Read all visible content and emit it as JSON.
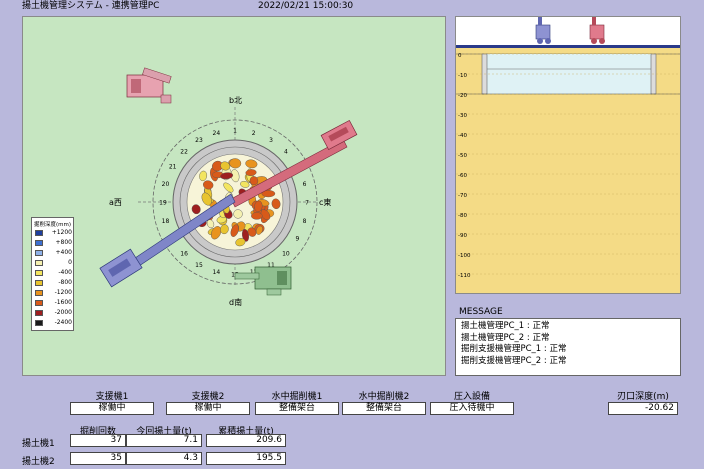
{
  "window": {
    "title": "揚土機管理システム - 連携管理PC",
    "datetime": "2022/02/21 15:00:30"
  },
  "plan": {
    "directions": {
      "north": "b北",
      "east": "c東",
      "south": "d南",
      "west": "a西"
    },
    "legend": {
      "title": "掘削深度(mm)",
      "items": [
        {
          "label": "+1200",
          "color": "#1f3f9e"
        },
        {
          "label": "+800",
          "color": "#3d6fd0"
        },
        {
          "label": "+400",
          "color": "#8fb1e8"
        },
        {
          "label": "0",
          "color": "#f4f0b0"
        },
        {
          "label": "-400",
          "color": "#f3e560"
        },
        {
          "label": "-800",
          "color": "#e8c430"
        },
        {
          "label": "-1200",
          "color": "#e8931e"
        },
        {
          "label": "-1600",
          "color": "#d85a1a"
        },
        {
          "label": "-2000",
          "color": "#9e1f1f"
        },
        {
          "label": "-2400",
          "color": "#1a1a1a"
        }
      ]
    },
    "ring_numbers": [
      "1",
      "2",
      "3",
      "4",
      "5",
      "6",
      "7",
      "8",
      "9",
      "10",
      "11",
      "12",
      "13",
      "14",
      "15",
      "16",
      "17",
      "18",
      "19",
      "20",
      "21",
      "22",
      "23",
      "24"
    ]
  },
  "section": {
    "ticks": [
      "0",
      "-10",
      "-20",
      "-30",
      "-40",
      "-50",
      "-60",
      "-70",
      "-80",
      "-90",
      "-100",
      "-110"
    ]
  },
  "message": {
    "label": "MESSAGE",
    "lines": [
      "揚土機管理PC_1 : 正常",
      "揚土機管理PC_2 : 正常",
      "掘削支援機管理PC_1 : 正常",
      "掘削支援機管理PC_2 : 正常"
    ]
  },
  "status": {
    "headers": [
      "支援機1",
      "支援機2",
      "水中掘削機1",
      "水中掘削機2",
      "圧入設備"
    ],
    "values": [
      "稼働中",
      "稼働中",
      "整備架台",
      "整備架台",
      "圧入待機中"
    ],
    "blade_depth_label": "刃口深度(m)",
    "blade_depth_value": "-20.62"
  },
  "counts": {
    "headers": [
      "掘削回数",
      "今回揚土量(t)",
      "累積揚土量(t)"
    ],
    "rows": [
      {
        "name": "揚土機1",
        "count": "37",
        "this_time": "7.1",
        "total": "209.6"
      },
      {
        "name": "揚土機2",
        "count": "35",
        "this_time": "4.3",
        "total": "195.5"
      }
    ]
  }
}
